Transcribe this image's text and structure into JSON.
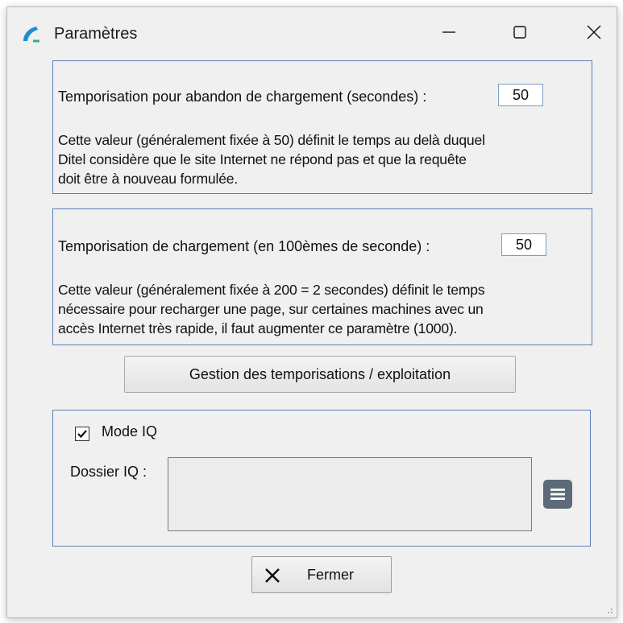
{
  "window": {
    "title": "Paramètres",
    "icon": "ditel-app-icon",
    "controls": {
      "minimize_icon": "minimize-icon",
      "maximize_icon": "maximize-icon",
      "close_icon": "close-icon"
    }
  },
  "abandon": {
    "label": "Temporisation pour abandon de chargement (secondes) :",
    "value": "50",
    "description": [
      "Cette valeur (généralement fixée à 50) définit le temps au delà duquel",
      "Ditel considère que le site Internet ne répond pas et que la requête",
      "doit être à nouveau formulée."
    ]
  },
  "loading": {
    "label": "Temporisation de chargement (en 100èmes de seconde) :",
    "value": "50",
    "description": [
      "Cette valeur (généralement fixée à 200 = 2 secondes) définit le temps",
      "nécessaire pour recharger une page, sur certaines machines avec un",
      "accès Internet très rapide, il faut augmenter ce paramètre (1000)."
    ]
  },
  "manage_button": {
    "label": "Gestion des temporisations / exploitation"
  },
  "iq": {
    "mode_label": "Mode IQ",
    "mode_checked": true,
    "folder_label": "Dossier IQ :",
    "folder_value": "",
    "browse_icon": "list-icon"
  },
  "footer": {
    "close_label": "Fermer",
    "close_icon": "x-icon"
  },
  "colors": {
    "group_border": "#5b7fb2",
    "window_bg": "#f0f0f0",
    "browse_bg": "#5d6a77"
  }
}
